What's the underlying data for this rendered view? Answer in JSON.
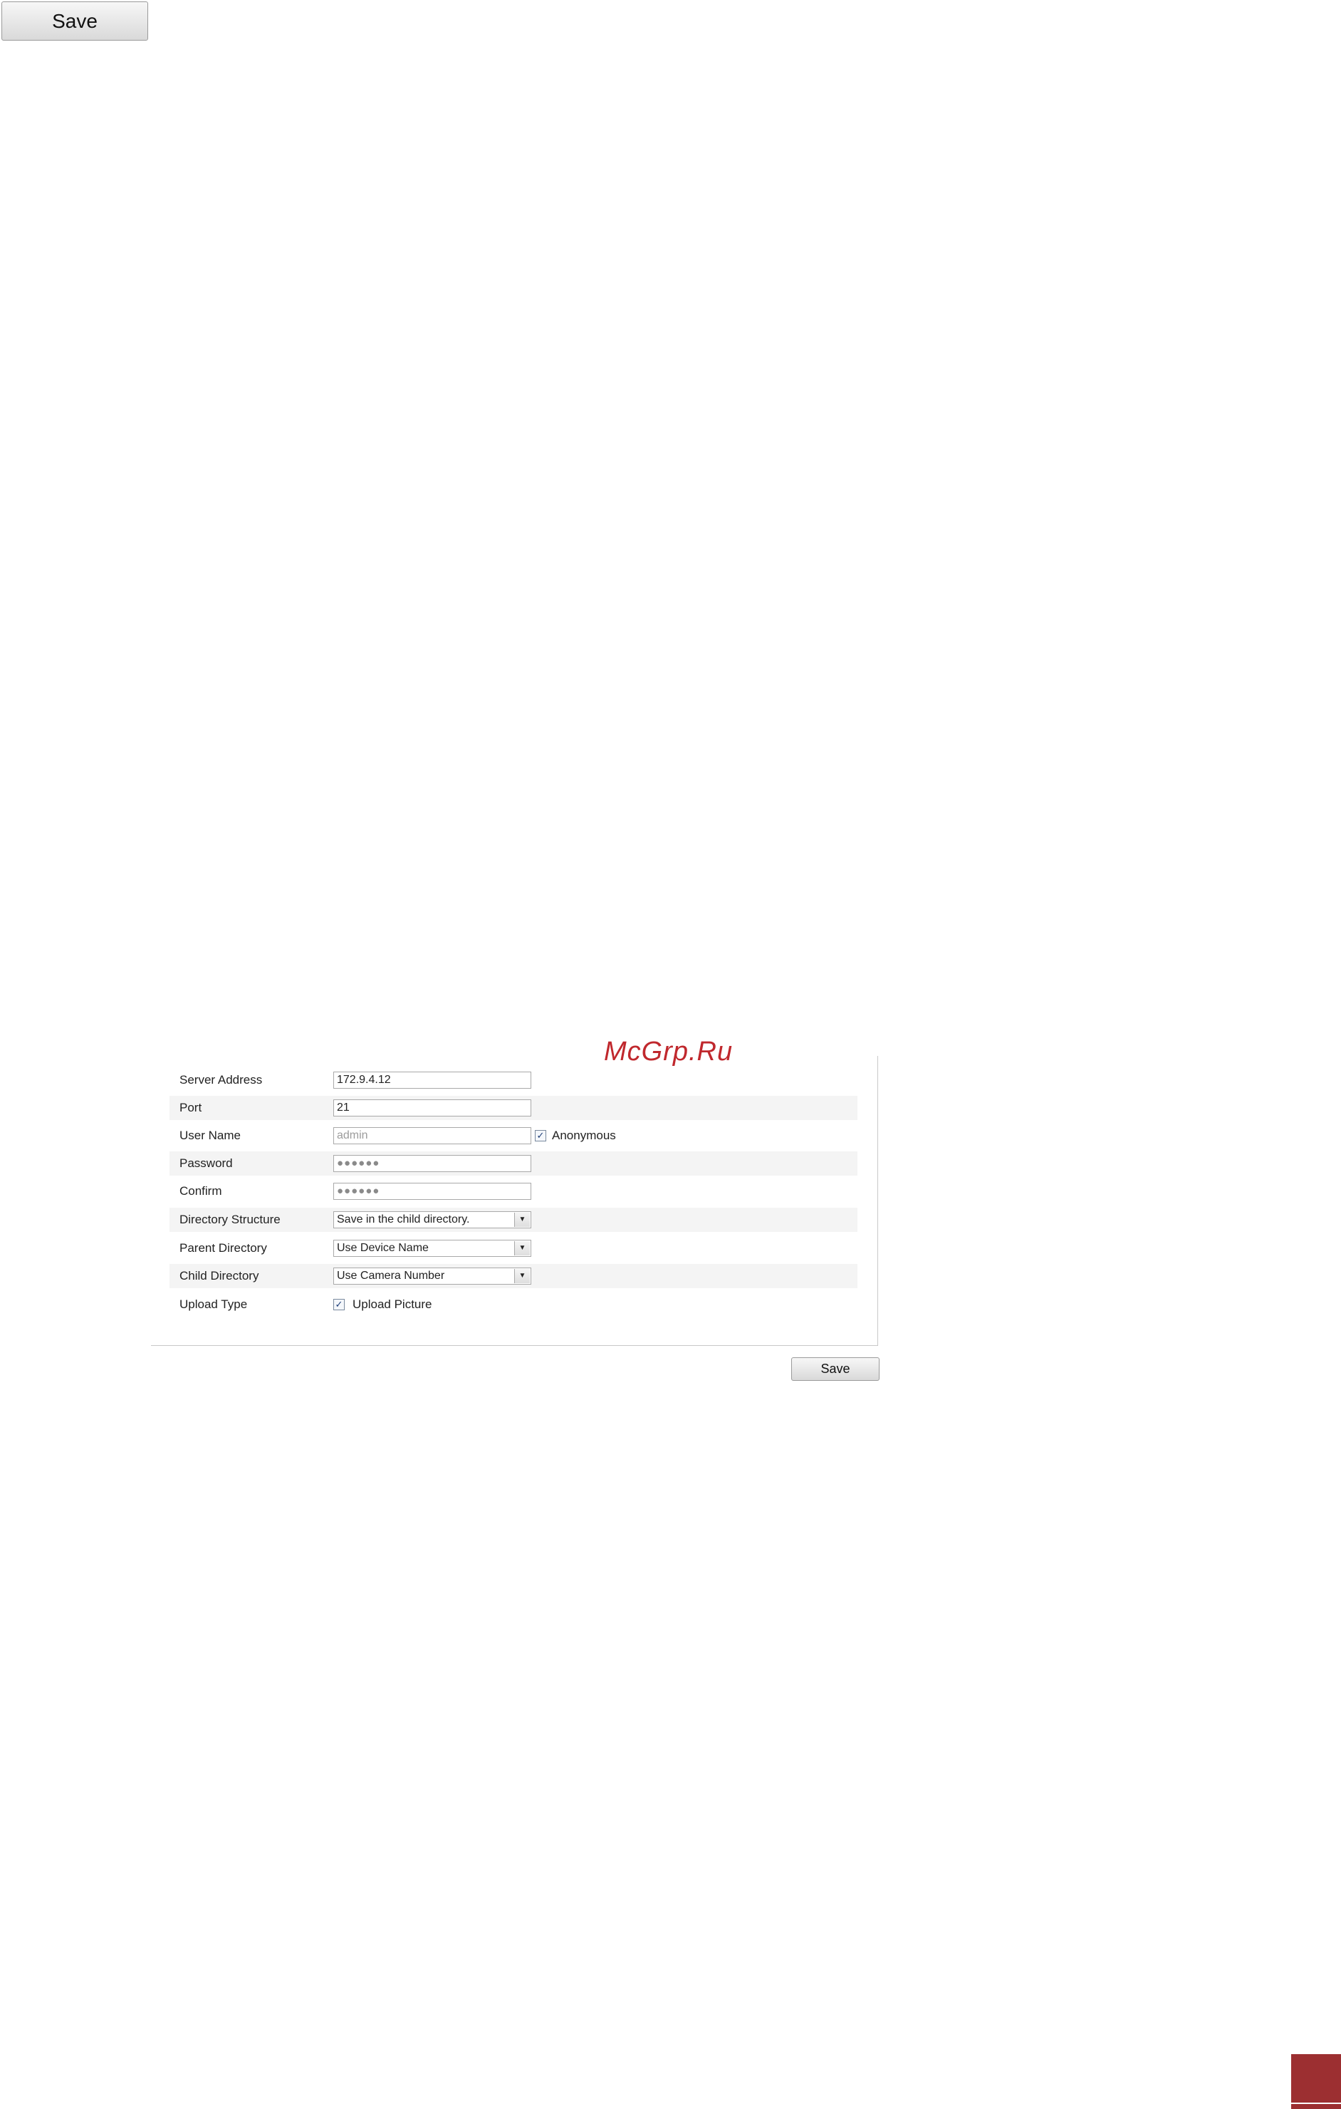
{
  "top_save_label": "Save",
  "watermark": "McGrp.Ru",
  "form": {
    "server_address": {
      "label": "Server Address",
      "value": "172.9.4.12"
    },
    "port": {
      "label": "Port",
      "value": "21"
    },
    "user_name": {
      "label": "User Name",
      "placeholder": "admin",
      "anonymous_label": "Anonymous",
      "anonymous_checked": true
    },
    "password": {
      "label": "Password",
      "value": "●●●●●●"
    },
    "confirm": {
      "label": "Confirm",
      "value": "●●●●●●"
    },
    "directory_structure": {
      "label": "Directory Structure",
      "selected": "Save in the child directory."
    },
    "parent_directory": {
      "label": "Parent Directory",
      "selected": "Use Device Name"
    },
    "child_directory": {
      "label": "Child Directory",
      "selected": "Use Camera Number"
    },
    "upload_type": {
      "label": "Upload Type",
      "option_label": "Upload Picture",
      "checked": true
    }
  },
  "bottom_save_label": "Save",
  "colors": {
    "accent": "#9c2f31",
    "watermark": "#c0282d",
    "stripe": "#f4f4f4"
  },
  "icons": {
    "dropdown_arrow": "chevron-down-icon",
    "checkmark": "check-icon"
  }
}
